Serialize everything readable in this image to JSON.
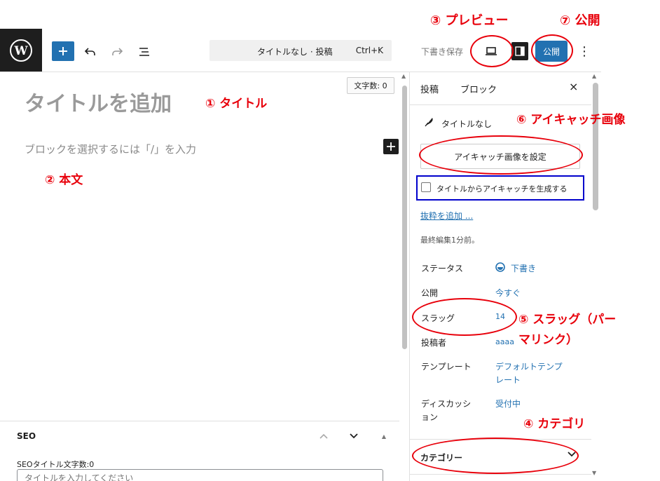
{
  "toolbar": {
    "doc_title": "タイトルなし · 投稿",
    "shortcut": "Ctrl+K",
    "save_draft": "下書き保存",
    "publish": "公開",
    "more": "⋮"
  },
  "editor": {
    "word_count": "文字数: 0",
    "title_placeholder": "タイトルを追加",
    "block_placeholder": "ブロックを選択するには「/」を入力"
  },
  "seo": {
    "title": "SEO",
    "title_count_label": "SEOタイトル文字数:0",
    "title_input_placeholder": "タイトルを入力してください"
  },
  "sidebar": {
    "tabs": [
      {
        "label": "投稿"
      },
      {
        "label": "ブロック"
      }
    ],
    "close": "×",
    "post_name": "タイトルなし",
    "set_featured_image": "アイキャッチ画像を設定",
    "generate_featured_from_title": "タイトルからアイキャッチを生成する",
    "add_excerpt": "抜粋を追加 ...",
    "last_edited": "最終編集1分前。",
    "meta": [
      {
        "label": "ステータス",
        "value": "下書き"
      },
      {
        "label": "公開",
        "value": "今すぐ"
      },
      {
        "label": "スラッグ",
        "value": "14"
      },
      {
        "label": "投稿者",
        "value": "aaaa"
      },
      {
        "label": "テンプレート",
        "value": "デフォルトテンプ\nレート"
      },
      {
        "label": "ディスカッシ\nョン",
        "value": "受付中"
      }
    ],
    "categories": "カテゴリー"
  },
  "annotations": {
    "title": "① タイトル",
    "body": "② 本文",
    "preview": "③ プレビュー",
    "category": "④ カテゴリ",
    "slug_line1": "⑤ スラッグ（パー",
    "slug_line2": "マリンク）",
    "featured": "⑥ アイキャッチ画像",
    "publish": "⑦ 公開"
  },
  "colors": {
    "accent": "#2271b1",
    "annotation": "#e8000b",
    "highlight_box": "#0000cc",
    "dark": "#1e1e1e"
  }
}
